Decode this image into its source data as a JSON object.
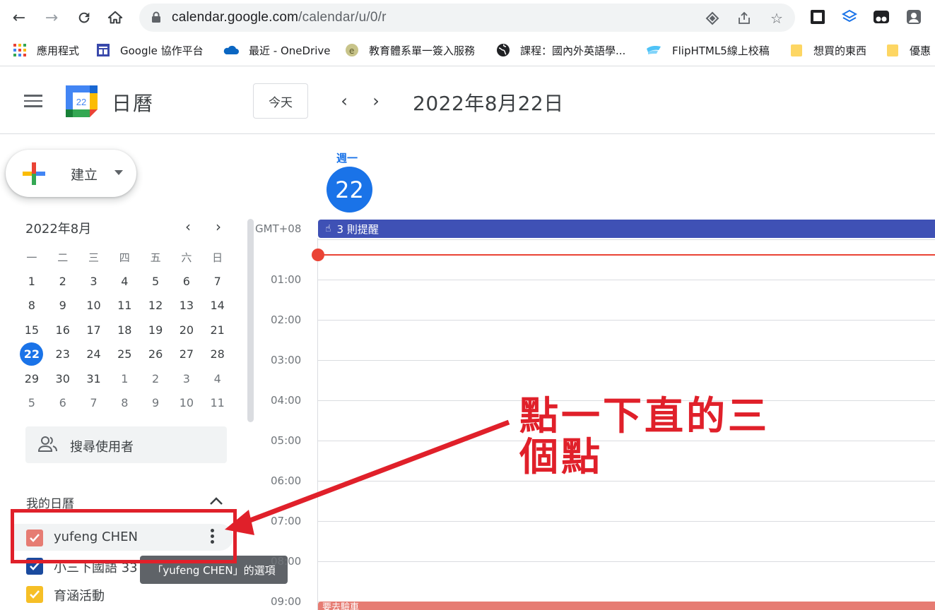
{
  "browser": {
    "url_host": "calendar.google.com",
    "url_path": "/calendar/u/0/r",
    "bookmarks": [
      {
        "label": "應用程式",
        "icon": "apps-grid-icon"
      },
      {
        "label": "Google 協作平台",
        "icon": "google-sites-icon"
      },
      {
        "label": "最近 - OneDrive",
        "icon": "onedrive-cloud-icon"
      },
      {
        "label": "教育體系單一簽入服務",
        "icon": "edu-sso-icon"
      },
      {
        "label": "課程：國內外英語學...",
        "icon": "globe-icon"
      },
      {
        "label": "FlipHTML5線上校稿",
        "icon": "fliphtml5-icon"
      },
      {
        "label": "想買的東西",
        "icon": "folder-icon"
      },
      {
        "label": "優惠",
        "icon": "folder-icon"
      }
    ]
  },
  "header": {
    "app_title": "日曆",
    "logo_day": "22",
    "today_label": "今天",
    "date_title": "2022年8月22日"
  },
  "sidebar": {
    "create_label": "建立",
    "mini_calendar": {
      "title": "2022年8月",
      "weekdays": [
        "一",
        "二",
        "三",
        "四",
        "五",
        "六",
        "日"
      ],
      "weeks": [
        [
          "1",
          "2",
          "3",
          "4",
          "5",
          "6",
          "7"
        ],
        [
          "8",
          "9",
          "10",
          "11",
          "12",
          "13",
          "14"
        ],
        [
          "15",
          "16",
          "17",
          "18",
          "19",
          "20",
          "21"
        ],
        [
          "22",
          "23",
          "24",
          "25",
          "26",
          "27",
          "28"
        ],
        [
          "29",
          "30",
          "31",
          "1",
          "2",
          "3",
          "4"
        ],
        [
          "5",
          "6",
          "7",
          "8",
          "9",
          "10",
          "11"
        ]
      ],
      "today": "22"
    },
    "search_people_label": "搜尋使用者",
    "my_calendars_title": "我的日曆",
    "calendars": [
      {
        "name": "yufeng CHEN",
        "color": "#e67c73"
      },
      {
        "name": "小三下國語 33",
        "color": "#1a4a9e"
      },
      {
        "name": "育涵活動",
        "color": "#f6bf26"
      }
    ],
    "tooltip": "「yufeng CHEN」的選項"
  },
  "day_view": {
    "weekday": "週一",
    "day_number": "22",
    "timezone": "GMT+08",
    "reminder": "3 則提醒",
    "hours": [
      "01:00",
      "02:00",
      "03:00",
      "04:00",
      "05:00",
      "06:00",
      "07:00",
      "08:00",
      "09:00"
    ],
    "bottom_event": "要去驗車"
  },
  "annotation": {
    "line1": "點一下直的三",
    "line2": "個點",
    "color": "#e0202a"
  }
}
